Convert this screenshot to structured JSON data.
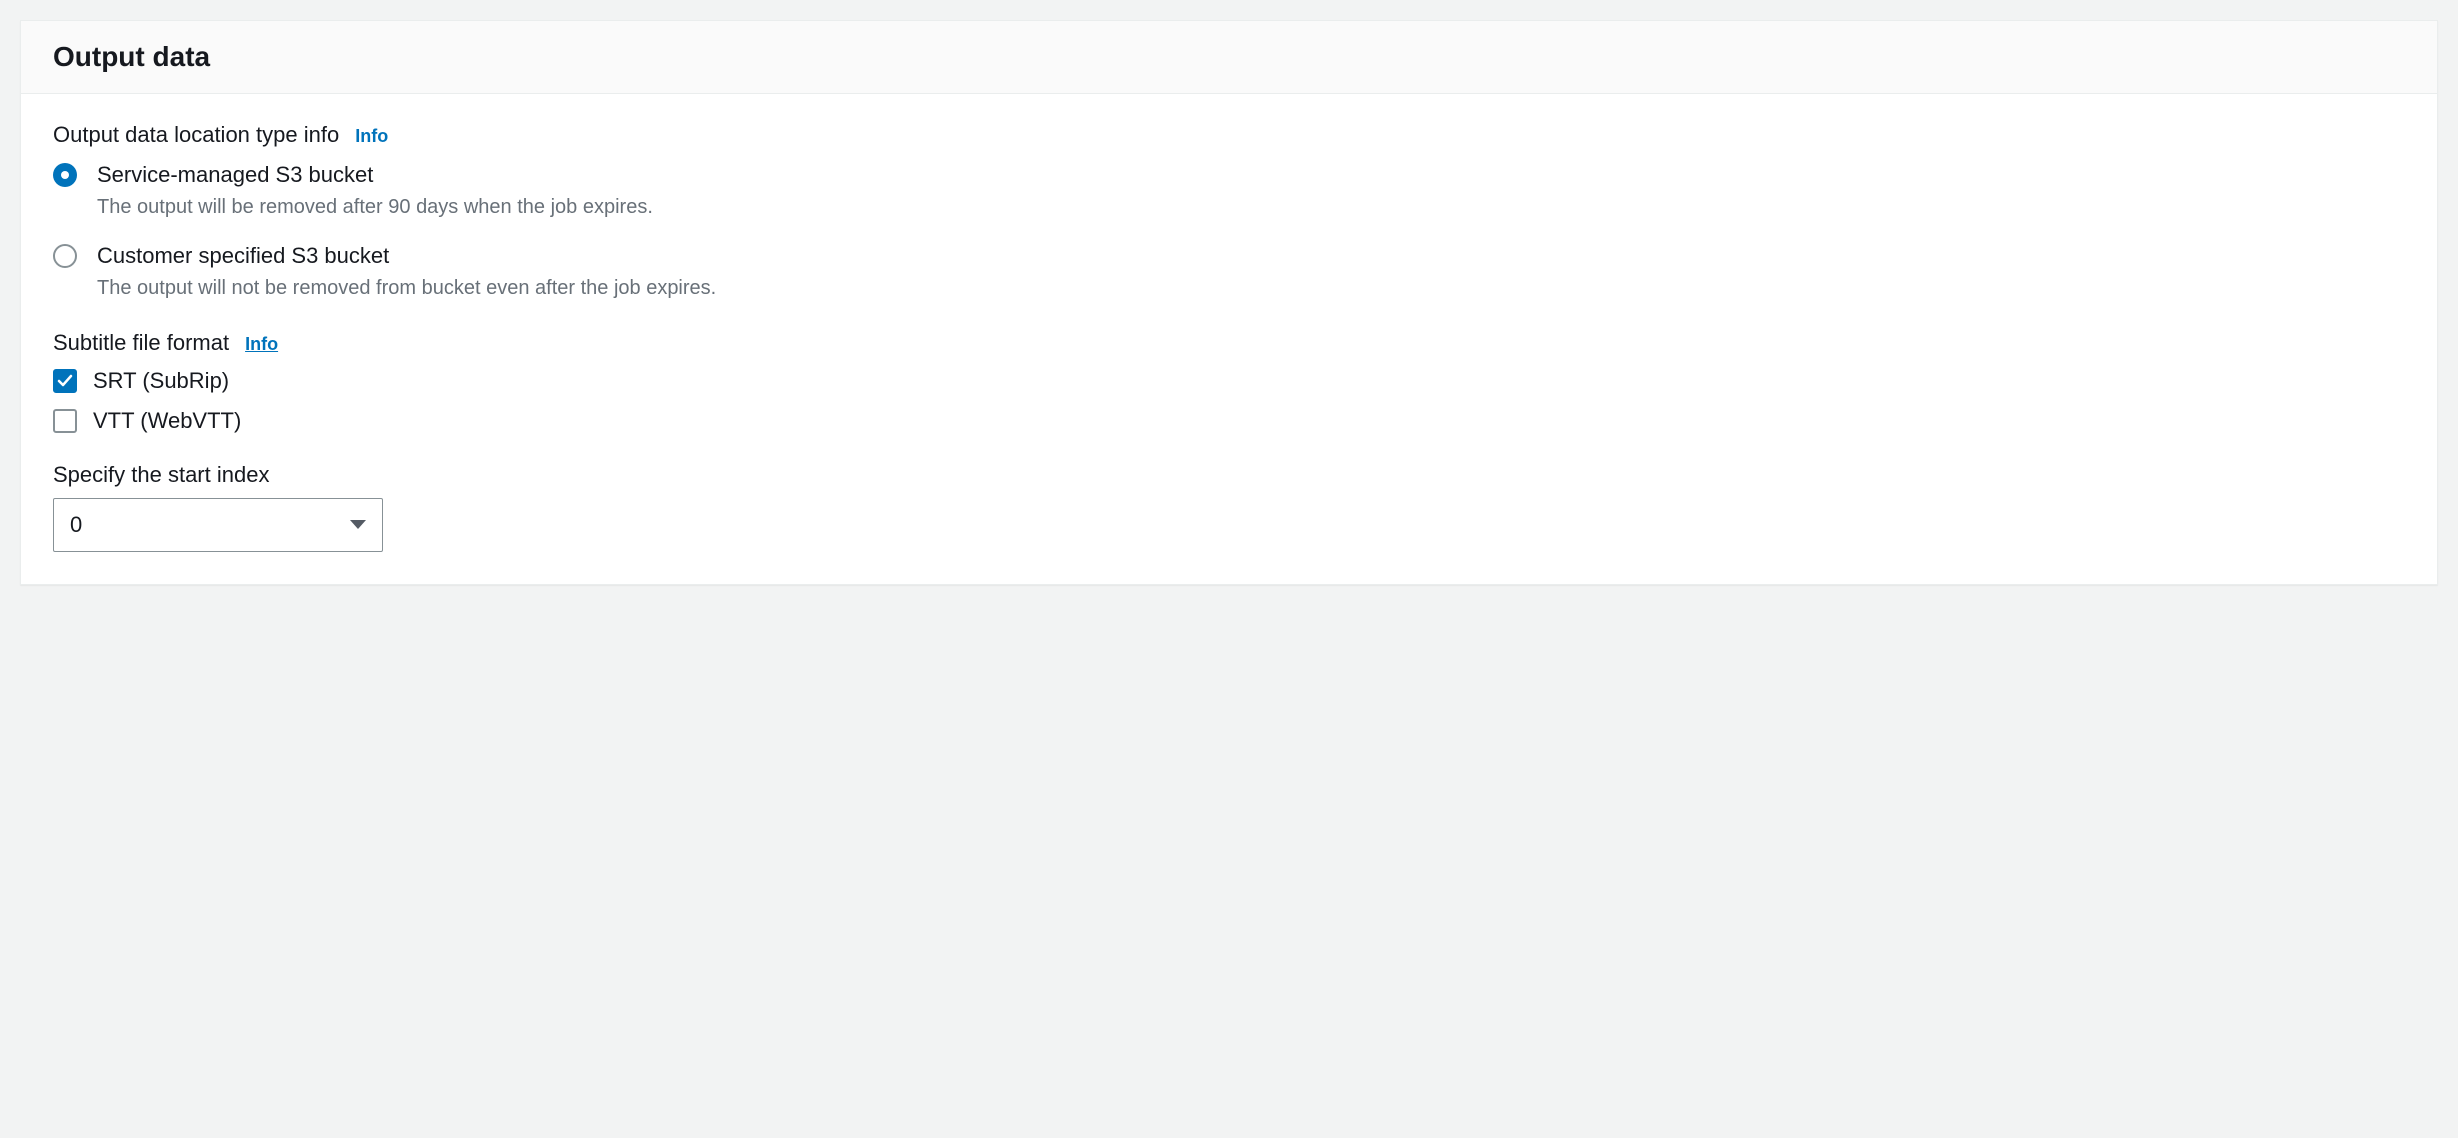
{
  "panel": {
    "title": "Output data"
  },
  "sections": {
    "location": {
      "label": "Output data location type info",
      "info_label": "Info",
      "options": [
        {
          "title": "Service-managed S3 bucket",
          "desc": "The output will be removed after 90 days when the job expires.",
          "selected": true
        },
        {
          "title": "Customer specified S3 bucket",
          "desc": "The output will not be removed from bucket even after the job expires.",
          "selected": false
        }
      ]
    },
    "subtitle": {
      "label": "Subtitle file format",
      "info_label": "Info",
      "options": [
        {
          "label": "SRT (SubRip)",
          "checked": true
        },
        {
          "label": "VTT (WebVTT)",
          "checked": false
        }
      ]
    },
    "start_index": {
      "label": "Specify the start index",
      "value": "0"
    }
  }
}
